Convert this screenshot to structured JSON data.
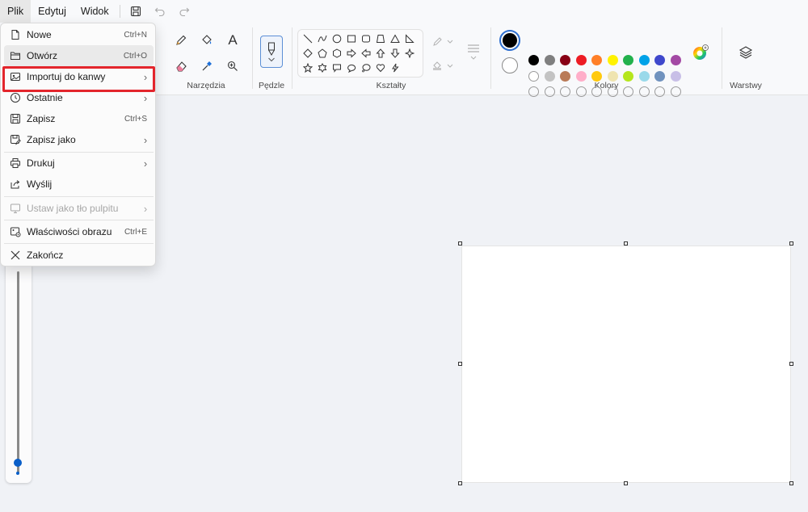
{
  "menubar": {
    "items": [
      "Plik",
      "Edytuj",
      "Widok"
    ]
  },
  "ribbon": {
    "groups": {
      "tools": "Narzędzia",
      "brushes": "Pędzle",
      "shapes": "Kształty",
      "colors": "Kolory",
      "layers": "Warstwy"
    },
    "text_tool_glyph": "A"
  },
  "colors": {
    "row1": [
      "#000000",
      "#7f7f7f",
      "#880015",
      "#ed1c24",
      "#ff7f27",
      "#fff200",
      "#22b14c",
      "#00a2e8",
      "#3f48cc",
      "#a349a4"
    ],
    "row2": [
      "#ffffff",
      "#c3c3c3",
      "#b97a57",
      "#ffaec9",
      "#ffc90e",
      "#efe4b0",
      "#b5e61d",
      "#99d9ea",
      "#7092be",
      "#c8bfe7"
    ],
    "row3_count": 10,
    "primary": "#000000",
    "secondary": "#ffffff"
  },
  "file_menu": {
    "items": [
      {
        "label": "Nowe",
        "shortcut": "Ctrl+N",
        "icon": "new-file-icon"
      },
      {
        "label": "Otwórz",
        "shortcut": "Ctrl+O",
        "icon": "folder-open-icon"
      },
      {
        "label": "Importuj do kanwy",
        "icon": "import-image-icon",
        "submenu": true
      },
      {
        "label": "Ostatnie",
        "icon": "clock-icon",
        "submenu": true
      },
      {
        "label": "Zapisz",
        "shortcut": "Ctrl+S",
        "icon": "save-icon"
      },
      {
        "label": "Zapisz jako",
        "icon": "save-as-icon",
        "submenu": true
      },
      {
        "label": "Drukuj",
        "icon": "printer-icon",
        "submenu": true
      },
      {
        "label": "Wyślij",
        "icon": "share-icon"
      },
      {
        "label": "Ustaw jako tło pulpitu",
        "icon": "desktop-background-icon",
        "submenu": true,
        "disabled": true
      },
      {
        "label": "Właściwości obrazu",
        "shortcut": "Ctrl+E",
        "icon": "image-properties-icon"
      },
      {
        "label": "Zakończ",
        "icon": "close-icon"
      }
    ],
    "submenu_arrow": "›"
  }
}
